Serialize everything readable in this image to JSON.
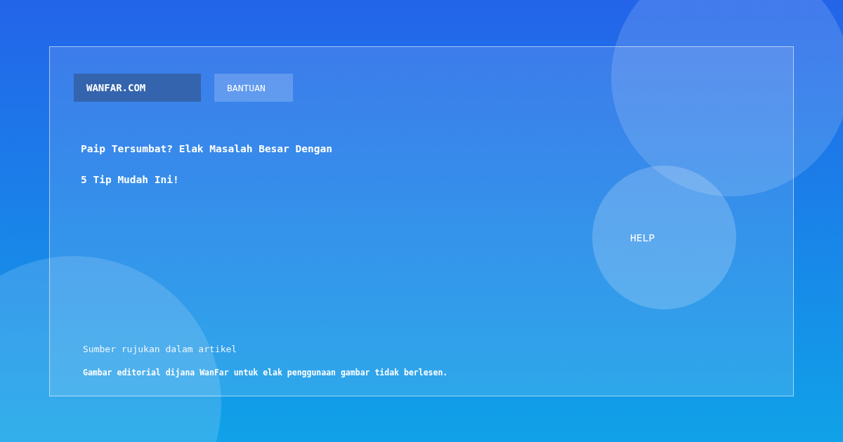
{
  "nav": [
    {
      "label": "WANFAR.COM",
      "selected": true
    },
    {
      "label": "BANTUAN",
      "selected": false
    }
  ],
  "headline": [
    "Paip Tersumbat? Elak Masalah Besar Dengan",
    "5 Tip Mudah Ini!"
  ],
  "help_button": "HELP",
  "source_note": "Sumber rujukan dalam artikel",
  "disclaimer": "Gambar editorial dijana WanFar untuk elak penggunaan gambar tidak berlesen."
}
